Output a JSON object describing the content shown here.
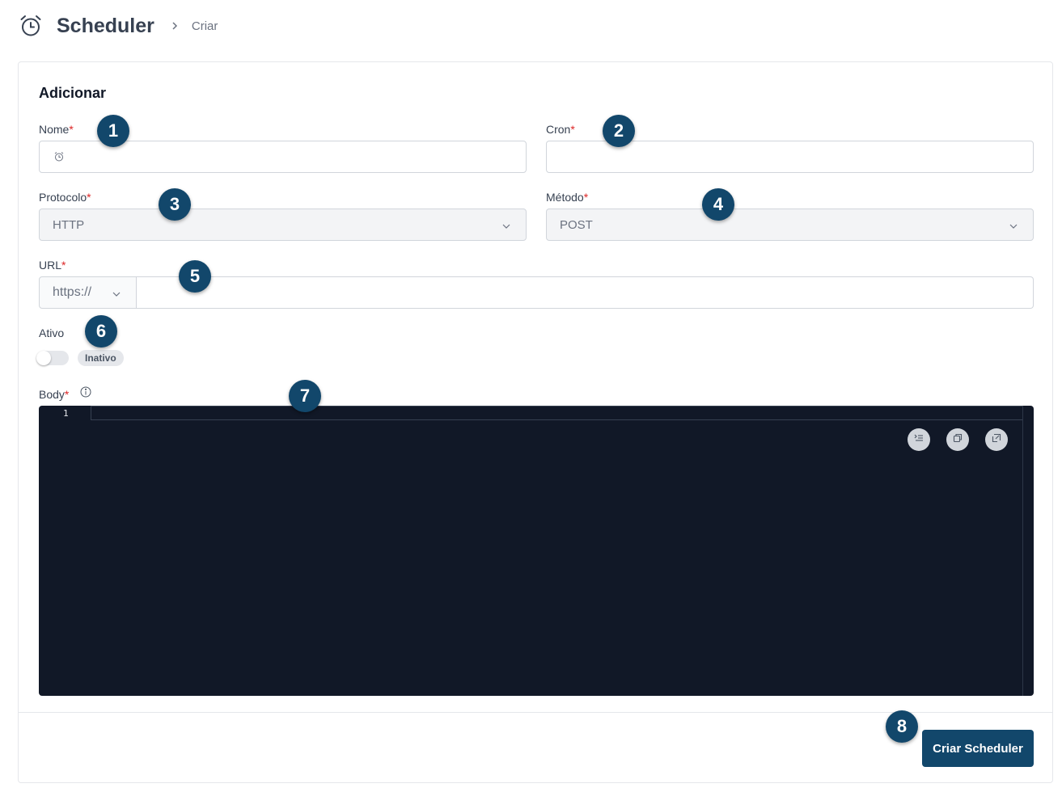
{
  "header": {
    "title": "Scheduler",
    "breadcrumb": "Criar"
  },
  "form": {
    "card_title": "Adicionar",
    "required_mark": "*",
    "name": {
      "label": "Nome",
      "value": ""
    },
    "cron": {
      "label": "Cron",
      "value": ""
    },
    "protocol": {
      "label": "Protocolo",
      "selected": "HTTP"
    },
    "method": {
      "label": "Método",
      "selected": "POST"
    },
    "url": {
      "label": "URL",
      "prefix": "https://",
      "value": ""
    },
    "active": {
      "label": "Ativo",
      "enabled": false,
      "status": "Inativo"
    },
    "body": {
      "label": "Body",
      "line_number": "1",
      "content": ""
    },
    "submit_label": "Criar Scheduler"
  },
  "markers": [
    "1",
    "2",
    "3",
    "4",
    "5",
    "6",
    "7",
    "8"
  ],
  "colors": {
    "primary": "#12476b",
    "required": "#dc2626",
    "editor_bg": "#111827"
  }
}
